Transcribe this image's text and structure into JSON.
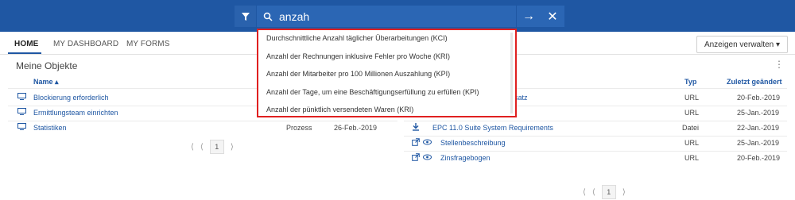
{
  "search": {
    "value": "anzah"
  },
  "tabs": [
    {
      "label": "HOME",
      "active": true
    },
    {
      "label": "MY DASHBOARD",
      "active": false
    },
    {
      "label": "MY FORMS",
      "active": false
    }
  ],
  "manage_button": "Anzeigen verwalten ▾",
  "section": {
    "title": "Meine Objekte"
  },
  "left_table": {
    "headers": {
      "name": "Name ▴"
    },
    "rows": [
      {
        "name": "Blockierung erforderlich",
        "type": "",
        "date": ""
      },
      {
        "name": "Ermittlungsteam einrichten",
        "type": "",
        "date": ""
      },
      {
        "name": "Statistiken",
        "type": "Prozess",
        "date": "26-Feb.-2019"
      }
    ],
    "pager": {
      "page": "1"
    }
  },
  "right_table": {
    "headers": {
      "type": "Typ",
      "modified": "Zuletzt geändert"
    },
    "rows": [
      {
        "name": "nsatz",
        "type": "URL",
        "date": "20-Feb.-2019"
      },
      {
        "name": "",
        "type": "URL",
        "date": "25-Jan.-2019"
      },
      {
        "name": "EPC 11.0 Suite System Requirements",
        "type": "Datei",
        "date": "22-Jan.-2019"
      },
      {
        "name": "Stellenbeschreibung",
        "type": "URL",
        "date": "25-Jan.-2019"
      },
      {
        "name": "Zinsfragebogen",
        "type": "URL",
        "date": "20-Feb.-2019"
      }
    ],
    "pager": {
      "page": "1"
    }
  },
  "suggestions": [
    "Durchschnittliche Anzahl täglicher Überarbeitungen (KCI)",
    "Anzahl der Rechnungen inklusive Fehler pro Woche (KRI)",
    "Anzahl der Mitarbeiter pro 100 Millionen Auszahlung (KPI)",
    "Anzahl der Tage, um eine Beschäftigungserfüllung zu erfüllen (KPI)",
    "Anzahl der pünktlich versendeten Waren (KRI)"
  ],
  "colors": {
    "brand": "#1f57a3",
    "highlight_border": "#e02020"
  }
}
